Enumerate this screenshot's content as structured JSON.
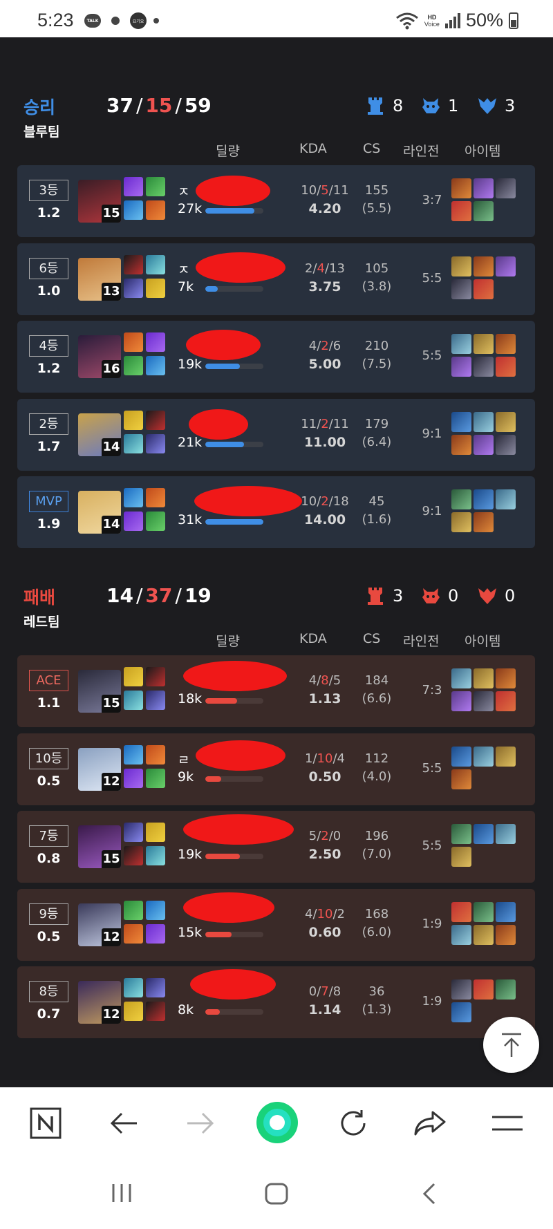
{
  "status": {
    "time": "5:23",
    "talk": "TALK",
    "app_badge": "요기요",
    "hd": "HD",
    "voice": "Voice",
    "battery": "50%"
  },
  "columns": {
    "damage": "딜량",
    "kda": "KDA",
    "cs": "CS",
    "lane": "라인전",
    "items": "아이템"
  },
  "win": {
    "result": "승리",
    "team": "블루팀",
    "kills": "37",
    "deaths": "15",
    "assists": "59",
    "towers": "8",
    "barons": "1",
    "dragons": "3",
    "result_color": "#3f8ee6",
    "players": [
      {
        "rank": "3등",
        "score": "1.2",
        "level": "15",
        "name_hint": "ㅈ",
        "damage": "27k",
        "damage_pct": 0.85,
        "k": "10",
        "d": "5",
        "a": "11",
        "ratio": "4.20",
        "cs": "155",
        "cs_min": "(5.5)",
        "lane": "3:7"
      },
      {
        "rank": "6등",
        "score": "1.0",
        "level": "13",
        "name_hint": "ㅈ",
        "damage": "7k",
        "damage_pct": 0.22,
        "k": "2",
        "d": "4",
        "a": "13",
        "ratio": "3.75",
        "cs": "105",
        "cs_min": "(3.8)",
        "lane": "5:5"
      },
      {
        "rank": "4등",
        "score": "1.2",
        "level": "16",
        "name_hint": "",
        "damage": "19k",
        "damage_pct": 0.6,
        "k": "4",
        "d": "2",
        "a": "6",
        "ratio": "5.00",
        "cs": "210",
        "cs_min": "(7.5)",
        "lane": "5:5"
      },
      {
        "rank": "2등",
        "score": "1.7",
        "level": "14",
        "name_hint": "",
        "damage": "21k",
        "damage_pct": 0.67,
        "k": "11",
        "d": "2",
        "a": "11",
        "ratio": "11.00",
        "cs": "179",
        "cs_min": "(6.4)",
        "lane": "9:1"
      },
      {
        "rank": "MVP",
        "score": "1.9",
        "level": "14",
        "name_hint": "",
        "damage": "31k",
        "damage_pct": 1.0,
        "k": "10",
        "d": "2",
        "a": "18",
        "ratio": "14.00",
        "cs": "45",
        "cs_min": "(1.6)",
        "lane": "9:1"
      }
    ]
  },
  "loss": {
    "result": "패배",
    "team": "레드팀",
    "kills": "14",
    "deaths": "37",
    "assists": "19",
    "towers": "3",
    "barons": "0",
    "dragons": "0",
    "result_color": "#e8493f",
    "players": [
      {
        "rank": "ACE",
        "score": "1.1",
        "level": "15",
        "name_hint": "",
        "damage": "18k",
        "damage_pct": 0.55,
        "k": "4",
        "d": "8",
        "a": "5",
        "ratio": "1.13",
        "cs": "184",
        "cs_min": "(6.6)",
        "lane": "7:3"
      },
      {
        "rank": "10등",
        "score": "0.5",
        "level": "12",
        "name_hint": "ㄹ",
        "damage": "9k",
        "damage_pct": 0.27,
        "k": "1",
        "d": "10",
        "a": "4",
        "ratio": "0.50",
        "cs": "112",
        "cs_min": "(4.0)",
        "lane": "5:5"
      },
      {
        "rank": "7등",
        "score": "0.8",
        "level": "15",
        "name_hint": "",
        "damage": "19k",
        "damage_pct": 0.6,
        "k": "5",
        "d": "2",
        "a": "0",
        "ratio": "2.50",
        "cs": "196",
        "cs_min": "(7.0)",
        "lane": "5:5"
      },
      {
        "rank": "9등",
        "score": "0.5",
        "level": "12",
        "name_hint": "",
        "damage": "15k",
        "damage_pct": 0.45,
        "k": "4",
        "d": "10",
        "a": "2",
        "ratio": "0.60",
        "cs": "168",
        "cs_min": "(6.0)",
        "lane": "1:9"
      },
      {
        "rank": "8등",
        "score": "0.7",
        "level": "12",
        "name_hint": "",
        "damage": "8k",
        "damage_pct": 0.25,
        "k": "0",
        "d": "7",
        "a": "8",
        "ratio": "1.14",
        "cs": "36",
        "cs_min": "(1.3)",
        "lane": "1:9"
      }
    ]
  },
  "icons": {
    "tower": "tower-icon",
    "baron": "baron-icon",
    "dragon": "dragon-icon",
    "scroll_top": "arrow-up-icon",
    "browser": [
      "naver-n-icon",
      "back-arrow-icon",
      "forward-arrow-icon",
      "home-green-icon",
      "refresh-icon",
      "share-icon",
      "menu-icon"
    ],
    "nav": [
      "recent-apps-icon",
      "home-icon",
      "back-icon"
    ]
  }
}
